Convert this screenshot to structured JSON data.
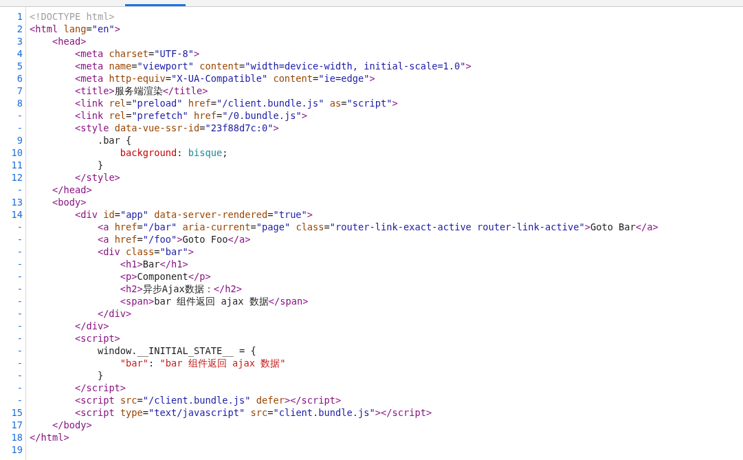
{
  "tabs": [
    {
      "selected": false
    },
    {
      "selected": true
    },
    {
      "selected": false
    }
  ],
  "code_lines": [
    {
      "number": "1",
      "tokens": [
        {
          "kind": "doctype",
          "text": "<!DOCTYPE html>"
        }
      ]
    },
    {
      "number": "2",
      "tokens": [
        {
          "kind": "tag",
          "text": "<html"
        },
        {
          "kind": "attr",
          "text": " lang"
        },
        {
          "kind": "punct",
          "text": "="
        },
        {
          "kind": "value",
          "text": "\"en\""
        },
        {
          "kind": "tag",
          "text": ">"
        }
      ]
    },
    {
      "number": "3",
      "tokens": [
        {
          "kind": "tag",
          "text": "    <head>"
        }
      ]
    },
    {
      "number": "4",
      "tokens": [
        {
          "kind": "tag",
          "text": "        <meta"
        },
        {
          "kind": "attr",
          "text": " charset"
        },
        {
          "kind": "punct",
          "text": "="
        },
        {
          "kind": "value",
          "text": "\"UTF-8\""
        },
        {
          "kind": "tag",
          "text": ">"
        }
      ]
    },
    {
      "number": "5",
      "tokens": [
        {
          "kind": "tag",
          "text": "        <meta"
        },
        {
          "kind": "attr",
          "text": " name"
        },
        {
          "kind": "punct",
          "text": "="
        },
        {
          "kind": "value",
          "text": "\"viewport\""
        },
        {
          "kind": "attr",
          "text": " content"
        },
        {
          "kind": "punct",
          "text": "="
        },
        {
          "kind": "value",
          "text": "\"width=device-width, initial-scale=1.0\""
        },
        {
          "kind": "tag",
          "text": ">"
        }
      ]
    },
    {
      "number": "6",
      "tokens": [
        {
          "kind": "tag",
          "text": "        <meta"
        },
        {
          "kind": "attr",
          "text": " http-equiv"
        },
        {
          "kind": "punct",
          "text": "="
        },
        {
          "kind": "value",
          "text": "\"X-UA-Compatible\""
        },
        {
          "kind": "attr",
          "text": " content"
        },
        {
          "kind": "punct",
          "text": "="
        },
        {
          "kind": "value",
          "text": "\"ie=edge\""
        },
        {
          "kind": "tag",
          "text": ">"
        }
      ]
    },
    {
      "number": "7",
      "tokens": [
        {
          "kind": "tag",
          "text": "        <title>"
        },
        {
          "kind": "text",
          "text": "服务端渲染"
        },
        {
          "kind": "tag",
          "text": "</title>"
        }
      ]
    },
    {
      "number": "8",
      "tokens": [
        {
          "kind": "tag",
          "text": "        <link"
        },
        {
          "kind": "attr",
          "text": " rel"
        },
        {
          "kind": "punct",
          "text": "="
        },
        {
          "kind": "value",
          "text": "\"preload\""
        },
        {
          "kind": "attr",
          "text": " href"
        },
        {
          "kind": "punct",
          "text": "="
        },
        {
          "kind": "value",
          "text": "\"/client.bundle.js\""
        },
        {
          "kind": "attr",
          "text": " as"
        },
        {
          "kind": "punct",
          "text": "="
        },
        {
          "kind": "value",
          "text": "\"script\""
        },
        {
          "kind": "tag",
          "text": ">"
        }
      ]
    },
    {
      "number": "-",
      "tokens": [
        {
          "kind": "tag",
          "text": "        <link"
        },
        {
          "kind": "attr",
          "text": " rel"
        },
        {
          "kind": "punct",
          "text": "="
        },
        {
          "kind": "value",
          "text": "\"prefetch\""
        },
        {
          "kind": "attr",
          "text": " href"
        },
        {
          "kind": "punct",
          "text": "="
        },
        {
          "kind": "value",
          "text": "\"/0.bundle.js\""
        },
        {
          "kind": "tag",
          "text": ">"
        }
      ]
    },
    {
      "number": "-",
      "tokens": [
        {
          "kind": "tag",
          "text": "        <style"
        },
        {
          "kind": "attr",
          "text": " data-vue-ssr-id"
        },
        {
          "kind": "punct",
          "text": "="
        },
        {
          "kind": "value",
          "text": "\"23f88d7c:0\""
        },
        {
          "kind": "tag",
          "text": ">"
        }
      ]
    },
    {
      "number": "9",
      "tokens": [
        {
          "kind": "text",
          "text": "            .bar {"
        }
      ]
    },
    {
      "number": "10",
      "tokens": [
        {
          "kind": "prop",
          "text": "                background"
        },
        {
          "kind": "punct",
          "text": ": "
        },
        {
          "kind": "cssvalue",
          "text": "bisque"
        },
        {
          "kind": "punct",
          "text": ";"
        }
      ]
    },
    {
      "number": "11",
      "tokens": [
        {
          "kind": "text",
          "text": "            }"
        }
      ]
    },
    {
      "number": "12",
      "tokens": [
        {
          "kind": "tag",
          "text": "        </style>"
        }
      ]
    },
    {
      "number": "-",
      "tokens": [
        {
          "kind": "tag",
          "text": "    </head>"
        }
      ]
    },
    {
      "number": "13",
      "tokens": [
        {
          "kind": "tag",
          "text": "    <body>"
        }
      ]
    },
    {
      "number": "14",
      "tokens": [
        {
          "kind": "tag",
          "text": "        <div"
        },
        {
          "kind": "attr",
          "text": " id"
        },
        {
          "kind": "punct",
          "text": "="
        },
        {
          "kind": "value",
          "text": "\"app\""
        },
        {
          "kind": "attr",
          "text": " data-server-rendered"
        },
        {
          "kind": "punct",
          "text": "="
        },
        {
          "kind": "value",
          "text": "\"true\""
        },
        {
          "kind": "tag",
          "text": ">"
        }
      ]
    },
    {
      "number": "-",
      "tokens": [
        {
          "kind": "tag",
          "text": "            <a"
        },
        {
          "kind": "attr",
          "text": " href"
        },
        {
          "kind": "punct",
          "text": "="
        },
        {
          "kind": "value",
          "text": "\"/bar\""
        },
        {
          "kind": "attr",
          "text": " aria-current"
        },
        {
          "kind": "punct",
          "text": "="
        },
        {
          "kind": "value",
          "text": "\"page\""
        },
        {
          "kind": "attr",
          "text": " class"
        },
        {
          "kind": "punct",
          "text": "="
        },
        {
          "kind": "value",
          "text": "\"router-link-exact-active router-link-active\""
        },
        {
          "kind": "tag",
          "text": ">"
        },
        {
          "kind": "text",
          "text": "Goto Bar"
        },
        {
          "kind": "tag",
          "text": "</a>"
        }
      ]
    },
    {
      "number": "-",
      "tokens": [
        {
          "kind": "tag",
          "text": "            <a"
        },
        {
          "kind": "attr",
          "text": " href"
        },
        {
          "kind": "punct",
          "text": "="
        },
        {
          "kind": "value",
          "text": "\"/foo\""
        },
        {
          "kind": "tag",
          "text": ">"
        },
        {
          "kind": "text",
          "text": "Goto Foo"
        },
        {
          "kind": "tag",
          "text": "</a>"
        }
      ]
    },
    {
      "number": "-",
      "tokens": [
        {
          "kind": "tag",
          "text": "            <div"
        },
        {
          "kind": "attr",
          "text": " class"
        },
        {
          "kind": "punct",
          "text": "="
        },
        {
          "kind": "value",
          "text": "\"bar\""
        },
        {
          "kind": "tag",
          "text": ">"
        }
      ]
    },
    {
      "number": "-",
      "tokens": [
        {
          "kind": "tag",
          "text": "                <h1>"
        },
        {
          "kind": "text",
          "text": "Bar"
        },
        {
          "kind": "tag",
          "text": "</h1>"
        }
      ]
    },
    {
      "number": "-",
      "tokens": [
        {
          "kind": "tag",
          "text": "                <p>"
        },
        {
          "kind": "text",
          "text": "Component"
        },
        {
          "kind": "tag",
          "text": "</p>"
        }
      ]
    },
    {
      "number": "-",
      "tokens": [
        {
          "kind": "tag",
          "text": "                <h2>"
        },
        {
          "kind": "text",
          "text": "异步Ajax数据："
        },
        {
          "kind": "tag",
          "text": "</h2>"
        }
      ]
    },
    {
      "number": "-",
      "tokens": [
        {
          "kind": "tag",
          "text": "                <span>"
        },
        {
          "kind": "text",
          "text": "bar 组件返回 ajax 数据"
        },
        {
          "kind": "tag",
          "text": "</span>"
        }
      ]
    },
    {
      "number": "-",
      "tokens": [
        {
          "kind": "tag",
          "text": "            </div>"
        }
      ]
    },
    {
      "number": "-",
      "tokens": [
        {
          "kind": "tag",
          "text": "        </div>"
        }
      ]
    },
    {
      "number": "-",
      "tokens": [
        {
          "kind": "tag",
          "text": "        <script>"
        }
      ]
    },
    {
      "number": "-",
      "tokens": [
        {
          "kind": "text",
          "text": "            window.__INITIAL_STATE__"
        },
        {
          "kind": "punct",
          "text": " = {"
        }
      ]
    },
    {
      "number": "-",
      "tokens": [
        {
          "kind": "string",
          "text": "                \"bar\""
        },
        {
          "kind": "punct",
          "text": ": "
        },
        {
          "kind": "string",
          "text": "\"bar 组件返回 ajax 数据\""
        }
      ]
    },
    {
      "number": "-",
      "tokens": [
        {
          "kind": "text",
          "text": "            }"
        }
      ]
    },
    {
      "number": "-",
      "tokens": [
        {
          "kind": "tag",
          "text": "        </script>"
        }
      ]
    },
    {
      "number": "-",
      "tokens": [
        {
          "kind": "tag",
          "text": "        <script"
        },
        {
          "kind": "attr",
          "text": " src"
        },
        {
          "kind": "punct",
          "text": "="
        },
        {
          "kind": "value",
          "text": "\"/client.bundle.js\""
        },
        {
          "kind": "attr",
          "text": " defer"
        },
        {
          "kind": "tag",
          "text": "></script>"
        }
      ]
    },
    {
      "number": "15",
      "tokens": [
        {
          "kind": "tag",
          "text": "        <script"
        },
        {
          "kind": "attr",
          "text": " type"
        },
        {
          "kind": "punct",
          "text": "="
        },
        {
          "kind": "value",
          "text": "\"text/javascript\""
        },
        {
          "kind": "attr",
          "text": " src"
        },
        {
          "kind": "punct",
          "text": "="
        },
        {
          "kind": "value",
          "text": "\"client.bundle.js\""
        },
        {
          "kind": "tag",
          "text": "></script>"
        }
      ]
    },
    {
      "number": "17",
      "tokens": [
        {
          "kind": "tag",
          "text": "    </body>"
        }
      ]
    },
    {
      "number": "18",
      "tokens": [
        {
          "kind": "tag",
          "text": "</html>"
        }
      ]
    },
    {
      "number": "19"
    }
  ]
}
